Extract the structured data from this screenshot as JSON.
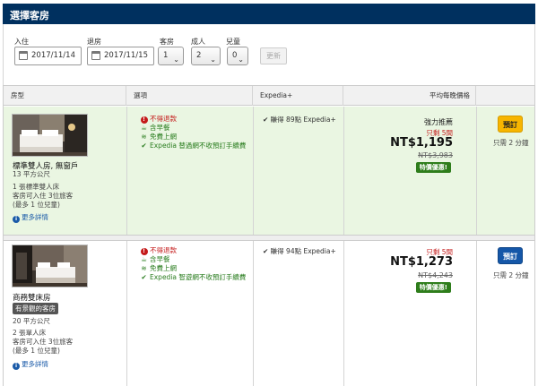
{
  "header": {
    "title": "選擇客房"
  },
  "search": {
    "checkin_label": "入住",
    "checkin_value": "2017/11/14",
    "checkout_label": "退房",
    "checkout_value": "2017/11/15",
    "rooms_label": "客房",
    "rooms_value": "1",
    "adults_label": "成人",
    "adults_value": "2",
    "children_label": "兒童",
    "children_value": "0",
    "update_label": "更新"
  },
  "table": {
    "headers": [
      "房型",
      "選項",
      "Expedia+",
      "平均每晚價格"
    ]
  },
  "rooms": [
    {
      "name": "標準雙人房, 無窗戶",
      "size": "13 平方公尺",
      "bed": "1 張標準雙人床",
      "occupancy": "客房可入住 3位旅客",
      "children": "(最多 1 位兒童)",
      "more": "更多詳情",
      "options": {
        "nonrefundable": "不得退款",
        "breakfast": "含早餐",
        "wifi": "免費上網",
        "no_fee": "Expedia 替過網不收預訂手續費"
      },
      "expedia_points": "賺得 89點 Expedia+",
      "promo": "強力推薦",
      "left": "只剩 5間",
      "price": "NT$1,195",
      "old_price": "NT$3,983",
      "deal": "特價優惠!",
      "book": "預訂",
      "time_left": "只需 2 分鐘"
    },
    {
      "name": "商務雙床房",
      "tag": "有景觀的客房",
      "size": "20 平方公尺",
      "bed": "2 張單人床",
      "occupancy": "客房可入住 3位旅客",
      "children": "(最多 1 位兒童)",
      "more": "更多詳情",
      "options": {
        "nonrefundable": "不得退款",
        "breakfast": "含早餐",
        "wifi": "免費上網",
        "no_fee": "Expedia 智遊網不收預訂手續費"
      },
      "expedia_points": "賺得 94點 Expedia+",
      "left": "只剩 5間",
      "price": "NT$1,273",
      "old_price": "NT$4,243",
      "deal": "特價優惠!",
      "book": "預訂",
      "time_left": "只需 2 分鐘"
    }
  ],
  "colors": {
    "header_bg": "#00305f",
    "row_highlight": "#eaf6e2",
    "book_yellow": "#f7b500",
    "book_blue": "#1557a8",
    "deal_green": "#2e7d1b"
  }
}
